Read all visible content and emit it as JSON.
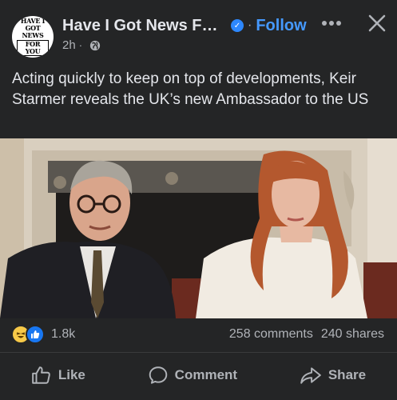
{
  "post": {
    "page_name": "Have I Got News For...",
    "follow_label": "Follow",
    "time": "2h",
    "text": "Acting quickly to keep on top of developments, Keir Starmer reveals the UK’s new Ambassador to the US",
    "logo_lines": [
      "HAVE I GOT NEWS",
      "FOR YOU"
    ]
  },
  "engagement": {
    "reaction_count": "1.8k",
    "comments": "258 comments",
    "shares": "240 shares"
  },
  "actions": {
    "like": "Like",
    "comment": "Comment",
    "share": "Share"
  },
  "colors": {
    "background": "#242526",
    "text": "#e4e6eb",
    "secondary_text": "#b0b3b8",
    "accent": "#4599ff"
  }
}
